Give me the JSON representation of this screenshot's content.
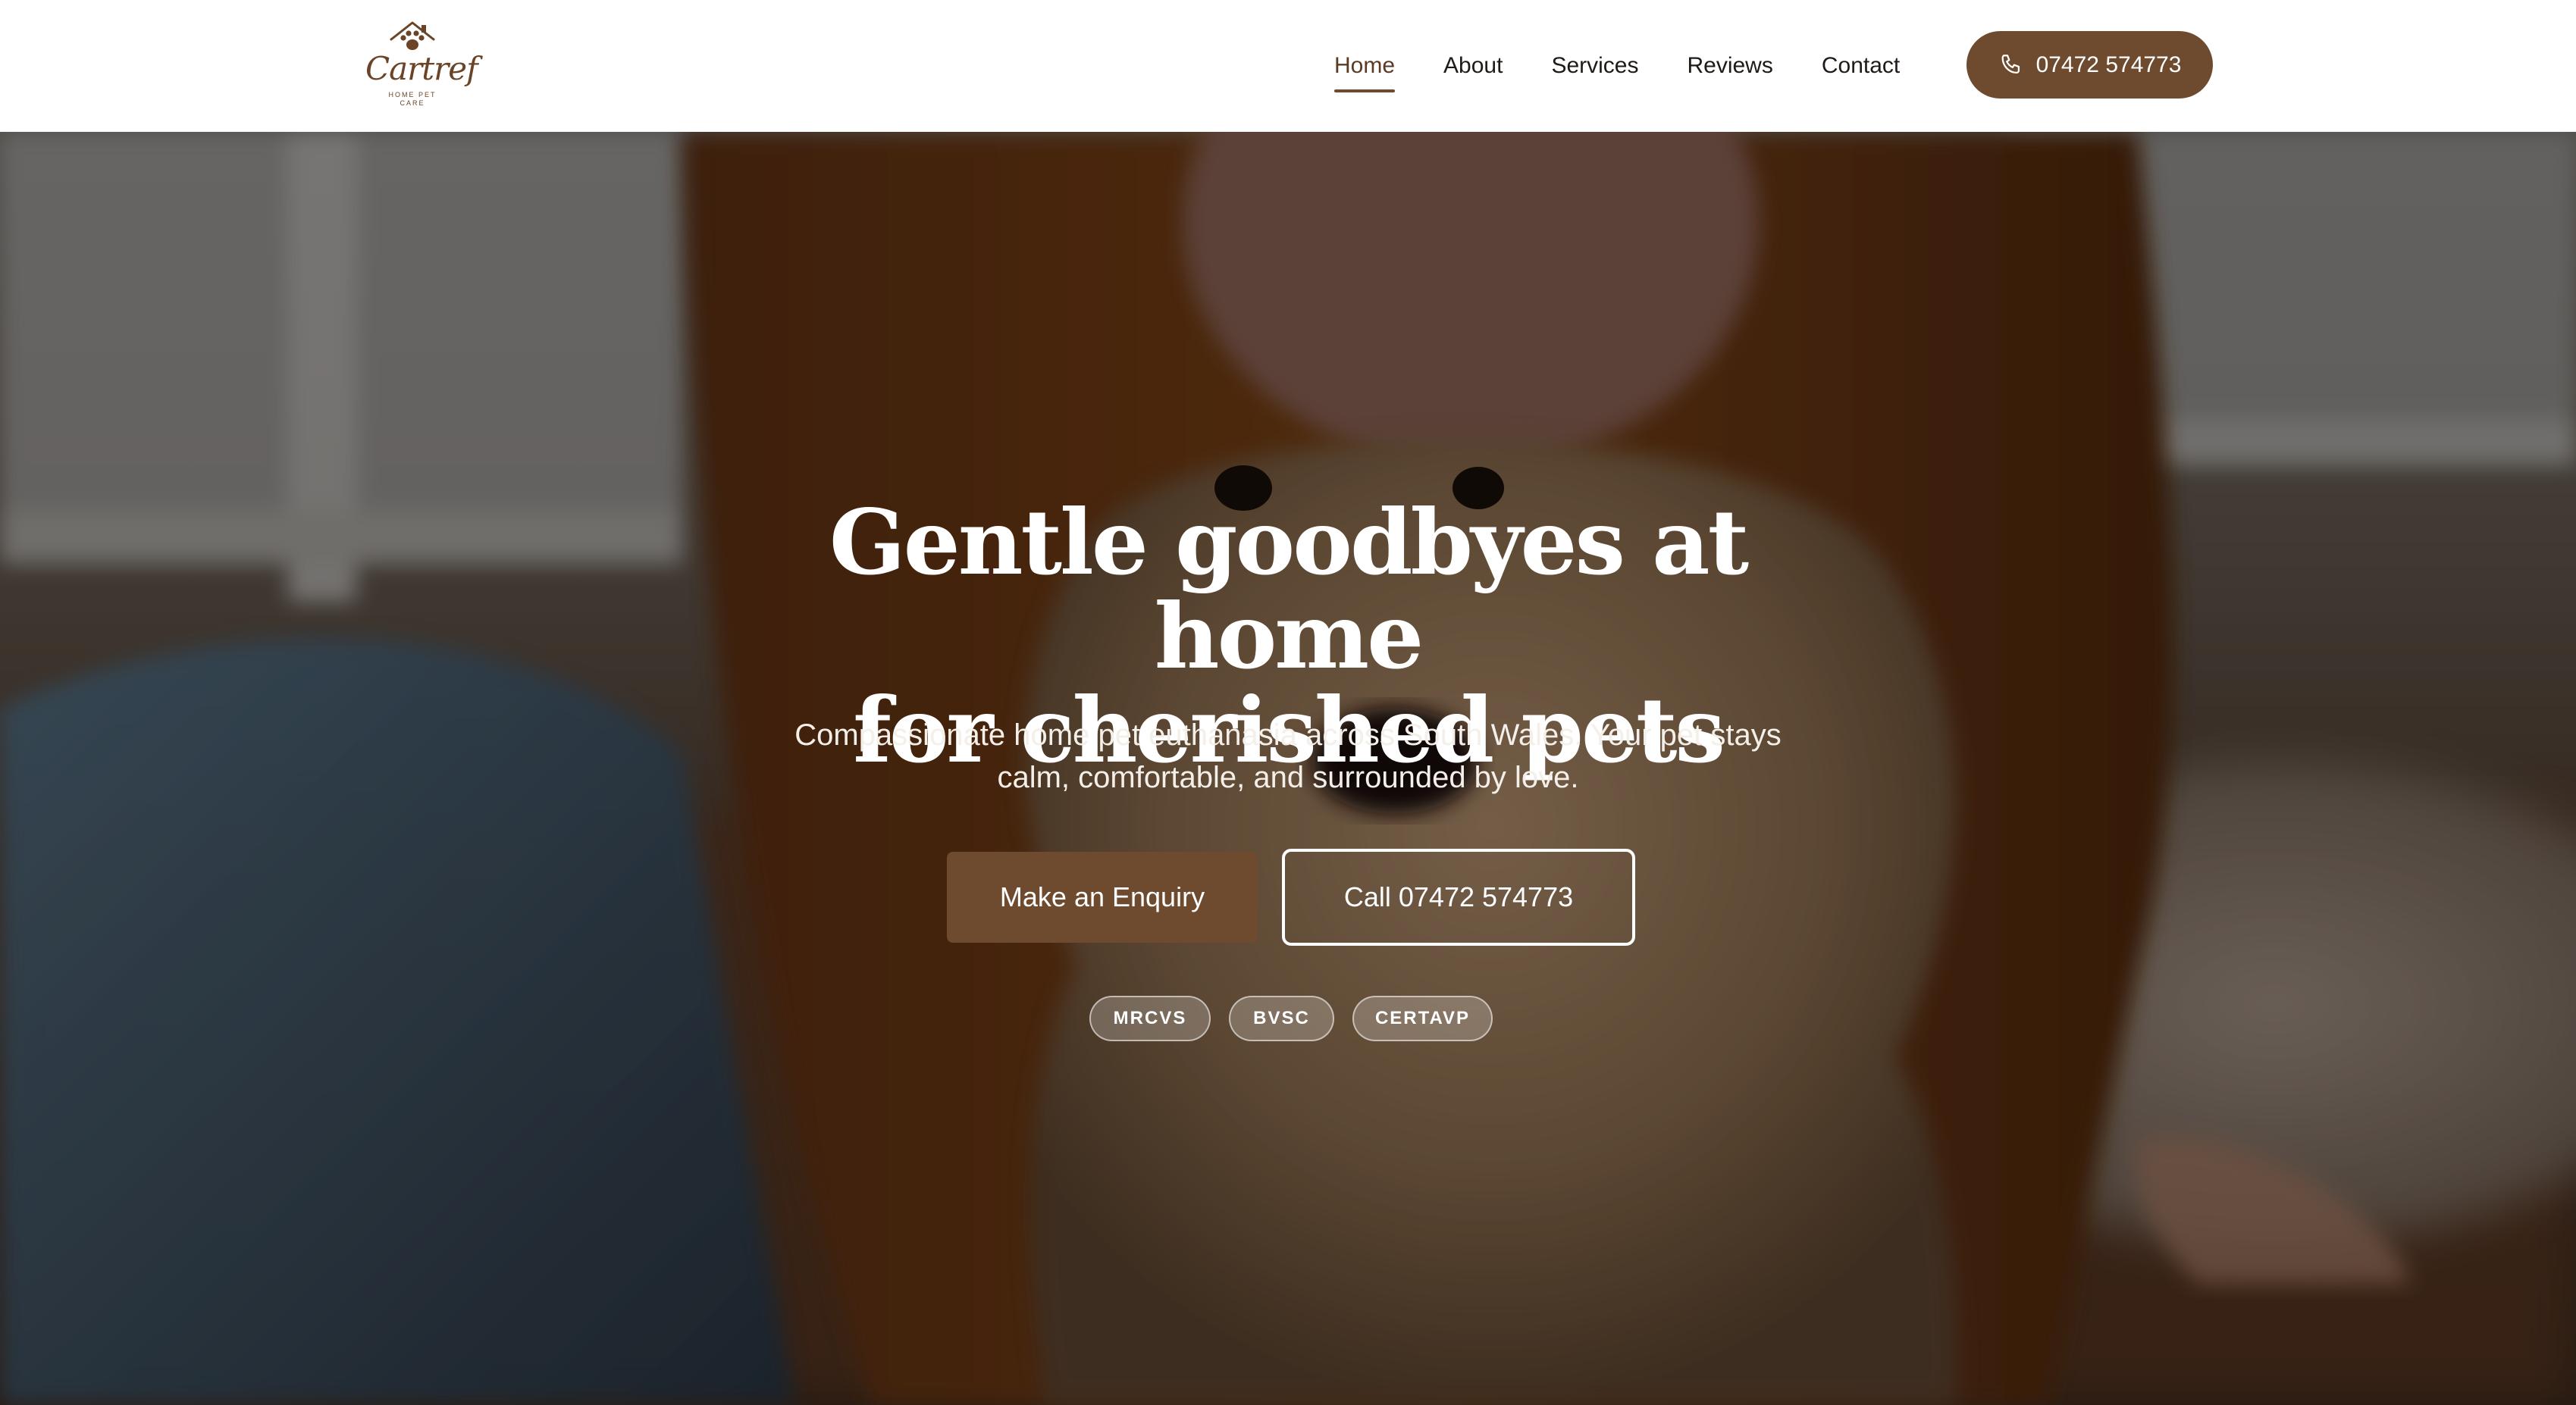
{
  "brand": {
    "name": "Cartref",
    "tagline_line1": "HOME PET",
    "tagline_line2": "CARE",
    "color": "#6e4a2e"
  },
  "nav": {
    "items": [
      {
        "label": "Home",
        "active": true
      },
      {
        "label": "About",
        "active": false
      },
      {
        "label": "Services",
        "active": false
      },
      {
        "label": "Reviews",
        "active": false
      },
      {
        "label": "Contact",
        "active": false
      }
    ],
    "phone_label": "07472 574773",
    "phone_icon": "phone-icon"
  },
  "hero": {
    "title_line1": "Gentle goodbyes at home",
    "title_line2": "for cherished pets",
    "subtitle_line1": "Compassionate home pet euthanasia across South Wales. Your pet stays",
    "subtitle_line2": "calm, comfortable, and surrounded by love.",
    "primary_cta": "Make an Enquiry",
    "secondary_cta": "Call 07472 574773",
    "badges": [
      "MRCVS",
      "BVSC",
      "CERTAVP"
    ]
  }
}
